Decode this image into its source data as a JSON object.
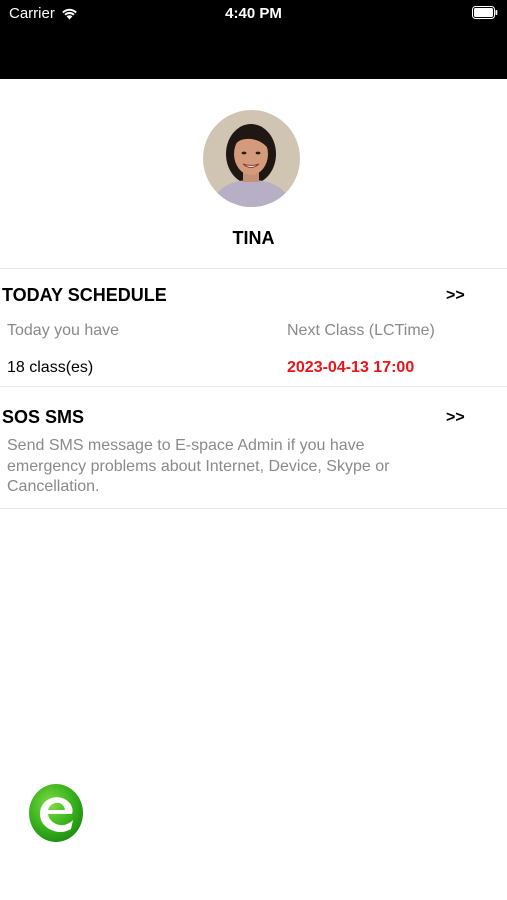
{
  "status_bar": {
    "carrier": "Carrier",
    "time": "4:40 PM"
  },
  "profile": {
    "name": "TINA"
  },
  "today_schedule": {
    "title": "TODAY SCHEDULE",
    "chevron": ">>",
    "today_label": "Today you have",
    "next_label": "Next Class (LCTime)",
    "today_value": "18 class(es)",
    "next_value": "2023-04-13 17:00"
  },
  "sos_sms": {
    "title": "SOS SMS",
    "chevron": ">>",
    "description": "Send SMS message to E-space Admin if you have emergency problems about Internet, Device, Skype or Cancellation."
  },
  "colors": {
    "accent_red": "#e8141a",
    "brand_green": "#3db31f"
  },
  "icons": [
    "wifi-icon",
    "battery-icon",
    "avatar-photo",
    "espace-logo-icon"
  ]
}
